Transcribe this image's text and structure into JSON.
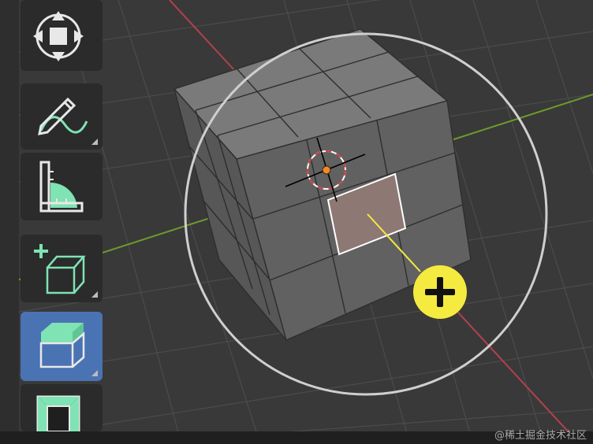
{
  "toolbar": {
    "items": [
      {
        "name": "tool-move",
        "icon": "move-arrows-icon",
        "active": false,
        "has_submenu": false
      },
      {
        "name": "tool-annotate",
        "icon": "pencil-annotate-icon",
        "active": false,
        "has_submenu": true
      },
      {
        "name": "tool-measure",
        "icon": "ruler-measure-icon",
        "active": false,
        "has_submenu": false
      },
      {
        "name": "tool-add-cube",
        "icon": "add-cube-icon",
        "active": false,
        "has_submenu": true
      },
      {
        "name": "tool-extrude-region",
        "icon": "extrude-region-icon",
        "active": true,
        "has_submenu": true
      },
      {
        "name": "tool-inset-faces",
        "icon": "inset-faces-icon",
        "active": false,
        "has_submenu": false
      }
    ]
  },
  "viewport": {
    "object": "cube",
    "x_axis_color": "#b3404f",
    "y_axis_color": "#6e9a2c",
    "selection_color": "#ffffff",
    "gizmo_color": "#f5ea40",
    "background": "#3a3a3a"
  },
  "watermark": {
    "text": "@稀土掘金技术社区"
  }
}
